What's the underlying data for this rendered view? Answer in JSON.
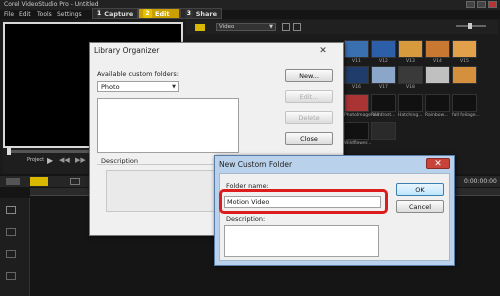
{
  "app": {
    "title": "Corel VideoStudio Pro - Untitled"
  },
  "menu": [
    "File",
    "Edit",
    "Tools",
    "Settings"
  ],
  "steps": [
    {
      "num": "1",
      "label": "Capture",
      "active": false
    },
    {
      "num": "2",
      "label": "Edit",
      "active": true
    },
    {
      "num": "3",
      "label": "Share",
      "active": false
    }
  ],
  "player": {
    "mode_label": "Project"
  },
  "library": {
    "category": "Video",
    "thumb_labels": [
      "V11",
      "V12",
      "V13",
      "V14",
      "V15",
      "V16",
      "V17",
      "V18",
      "PhotoImage Vid...",
      "Rainfrost...",
      "Hatching...",
      "Rainbow...",
      "fall foliage...",
      "Wildflower..."
    ]
  },
  "timeline": {
    "timecode": "0:00:00:00"
  },
  "library_organizer": {
    "title": "Library Organizer",
    "available_label": "Available custom folders:",
    "folder_select": "Photo",
    "description_label": "Description",
    "buttons": {
      "new": "New...",
      "edit": "Edit...",
      "delete": "Delete",
      "close": "Close"
    }
  },
  "new_folder": {
    "title": "New Custom Folder",
    "folder_name_label": "Folder name:",
    "folder_name_value": "Motion Video",
    "description_label": "Description:",
    "buttons": {
      "ok": "OK",
      "cancel": "Cancel"
    }
  },
  "colors": {
    "accent": "#caa000",
    "highlight": "#dd1c1c",
    "dialog_blue": "#b9d1ea"
  }
}
